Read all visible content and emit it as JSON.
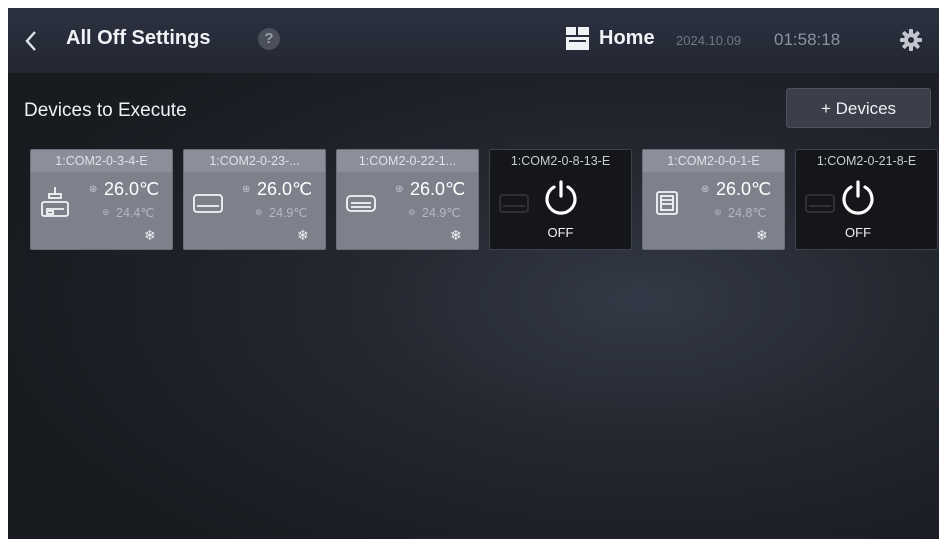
{
  "header": {
    "back_icon": "chevron-left-icon",
    "title": "All Off Settings",
    "help_icon": "question-circle-icon",
    "help_glyph": "?",
    "location_icon": "home-layout-icon",
    "location": "Home",
    "date": "2024.10.09",
    "time": "01:58:18",
    "settings_icon": "gear-icon"
  },
  "section": {
    "title": "Devices to Execute",
    "add_button": "+ Devices"
  },
  "colors": {
    "card_on": "#7d818b",
    "card_off": "#141619",
    "background": "#1f232b"
  },
  "devices": [
    {
      "name": "1:COM2-0-3-4-E",
      "state": "on",
      "icon": "ceiling-unit-icon",
      "set_temp": "26.0℃",
      "room_temp": "24.4℃",
      "mode_icon": "snowflake-icon"
    },
    {
      "name": "1:COM2-0-23-...",
      "state": "on",
      "icon": "wall-unit-icon",
      "set_temp": "26.0℃",
      "room_temp": "24.9℃",
      "mode_icon": "snowflake-icon"
    },
    {
      "name": "1:COM2-0-22-1...",
      "state": "on",
      "icon": "duct-unit-icon",
      "set_temp": "26.0℃",
      "room_temp": "24.9℃",
      "mode_icon": "snowflake-icon"
    },
    {
      "name": "1:COM2-0-8-13-E",
      "state": "off",
      "icon": "wall-unit-icon",
      "power_icon": "power-icon",
      "status": "OFF"
    },
    {
      "name": "1:COM2-0-0-1-E",
      "state": "on",
      "icon": "cassette-unit-icon",
      "set_temp": "26.0℃",
      "room_temp": "24.8℃",
      "mode_icon": "snowflake-icon"
    },
    {
      "name": "1:COM2-0-21-8-E",
      "state": "off",
      "icon": "wall-unit-icon",
      "power_icon": "power-icon",
      "status": "OFF"
    }
  ]
}
